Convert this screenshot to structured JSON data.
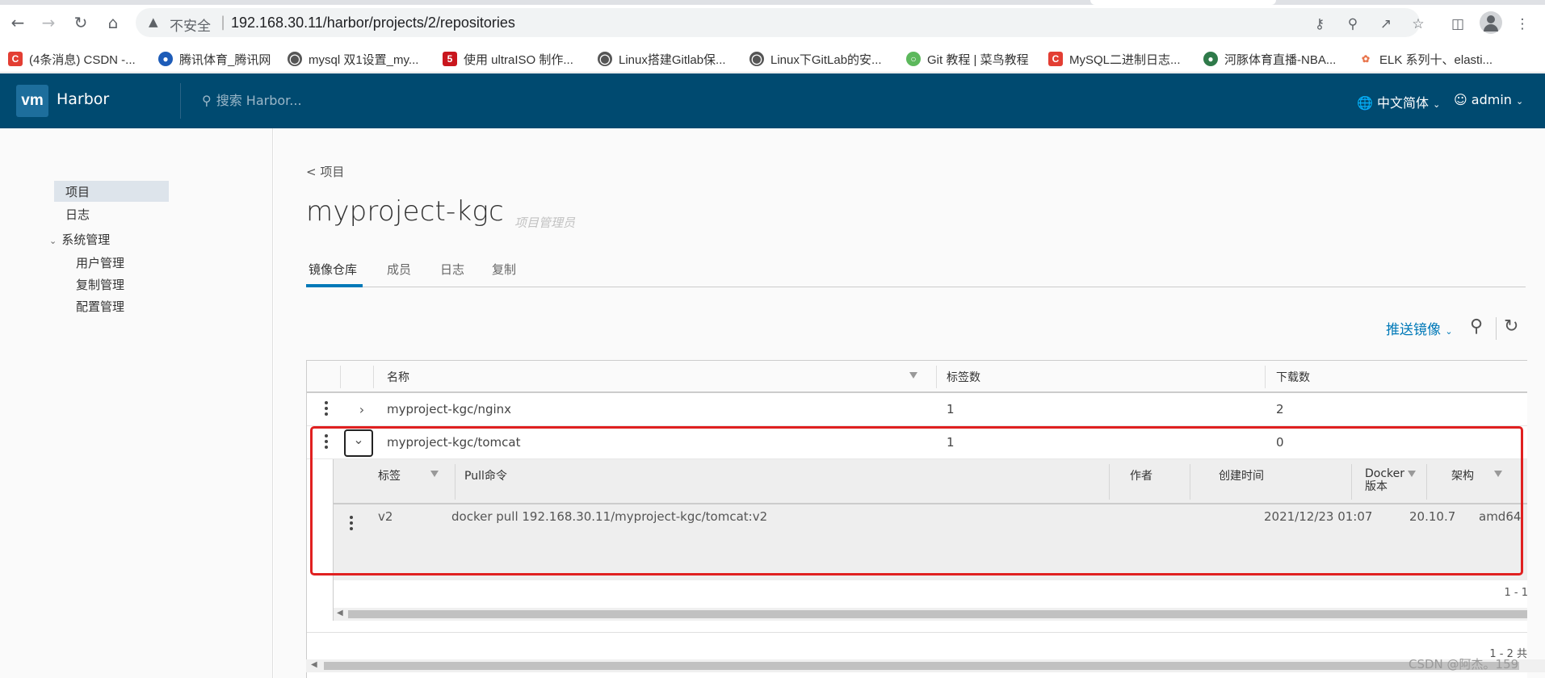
{
  "browser": {
    "insecure_label": "不安全",
    "separator": "|",
    "url": "192.168.30.11/harbor/projects/2/repositories"
  },
  "bookmarks": [
    {
      "label": "(4条消息) CSDN -...",
      "icon": "csdn-icon",
      "color": "#e33e33"
    },
    {
      "label": "腾讯体育_腾讯网",
      "icon": "tencent-sports-icon",
      "color": "#1d5cb8"
    },
    {
      "label": "mysql 双1设置_my...",
      "icon": "globe-icon",
      "color": "#555555"
    },
    {
      "label": "使用 ultraISO 制作...",
      "icon": "51cto-icon",
      "color": "#c9161d"
    },
    {
      "label": "Linux搭建Gitlab保...",
      "icon": "globe-icon",
      "color": "#555555"
    },
    {
      "label": "Linux下GitLab的安...",
      "icon": "globe-icon",
      "color": "#555555"
    },
    {
      "label": "Git 教程 | 菜鸟教程",
      "icon": "runoob-icon",
      "color": "#5cb85c"
    },
    {
      "label": "MySQL二进制日志...",
      "icon": "csdn-icon",
      "color": "#e33e33"
    },
    {
      "label": "河豚体育直播-NBA...",
      "icon": "hetun-icon",
      "color": "#2f7a4a"
    },
    {
      "label": "ELK 系列十、elasti...",
      "icon": "bookmark-icon",
      "color": "#e8734a"
    }
  ],
  "header": {
    "logo_text": "vm",
    "brand": "Harbor",
    "search_placeholder": "搜索 Harbor...",
    "language": "中文简体",
    "user": "admin"
  },
  "sidebar": {
    "items": [
      {
        "label": "项目",
        "active": true
      },
      {
        "label": "日志",
        "active": false
      },
      {
        "label": "系统管理",
        "active": false,
        "expanded": true
      }
    ],
    "admin_items": [
      {
        "label": "用户管理"
      },
      {
        "label": "复制管理"
      },
      {
        "label": "配置管理"
      }
    ]
  },
  "main": {
    "back_label": "< 项目",
    "project_name": "myproject-kgc",
    "role": "项目管理员",
    "tabs": [
      {
        "label": "镜像仓库",
        "active": true
      },
      {
        "label": "成员",
        "active": false
      },
      {
        "label": "日志",
        "active": false
      },
      {
        "label": "复制",
        "active": false
      }
    ],
    "push_label": "推送镜像"
  },
  "repo_grid": {
    "columns": [
      "名称",
      "标签数",
      "下载数"
    ],
    "rows": [
      {
        "name": "myproject-kgc/nginx",
        "tags": "1",
        "pulls": "2",
        "expanded": false
      },
      {
        "name": "myproject-kgc/tomcat",
        "tags": "1",
        "pulls": "0",
        "expanded": true
      }
    ],
    "footer": "1 - 2 共"
  },
  "tag_grid": {
    "columns": {
      "tag": "标签",
      "pull": "Pull命令",
      "author": "作者",
      "created": "创建时间",
      "docker_line1": "Docker",
      "docker_line2": "版本",
      "arch": "架构"
    },
    "rows": [
      {
        "tag": "v2",
        "pull": "docker pull 192.168.30.11/myproject-kgc/tomcat:v2",
        "author": "",
        "created": "2021/12/23 01:07",
        "docker": "20.10.7",
        "arch": "amd64"
      }
    ],
    "footer": "1 - 1"
  },
  "watermark": "CSDN @阿杰。159",
  "colors": {
    "header_bg": "#004a70",
    "accent": "#0079b8",
    "highlight": "#e02020"
  }
}
